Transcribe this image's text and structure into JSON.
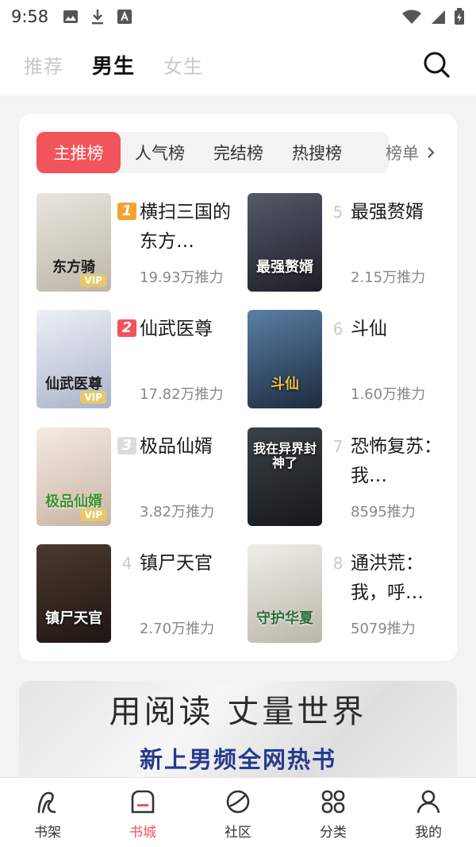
{
  "status": {
    "time": "9:58"
  },
  "top_tabs": [
    {
      "label": "推荐"
    },
    {
      "label": "男生"
    },
    {
      "label": "女生"
    }
  ],
  "rank_tabs": [
    {
      "label": "主推榜"
    },
    {
      "label": "人气榜"
    },
    {
      "label": "完结榜"
    },
    {
      "label": "热搜榜"
    }
  ],
  "rank_more": "榜单",
  "books": [
    {
      "rank": "1",
      "title": "横扫三国的东方…",
      "metric": "19.93万推力",
      "cover_text": "东方骑",
      "cover_color": "#d8d4cc"
    },
    {
      "rank": "2",
      "title": "仙武医尊",
      "metric": "17.82万推力",
      "cover_text": "仙武医尊",
      "cover_color": "#cfd6e4"
    },
    {
      "rank": "3",
      "title": "极品仙婿",
      "metric": "3.82万推力",
      "cover_text": "极品仙婿",
      "cover_color": "#e4d7cf"
    },
    {
      "rank": "4",
      "title": "镇尸天官",
      "metric": "2.70万推力",
      "cover_text": "镇尸天官",
      "cover_color": "#3a2a22"
    },
    {
      "rank": "5",
      "title": "最强赘婿",
      "metric": "2.15万推力",
      "cover_text": "最强赘婿",
      "cover_color": "#2c2f3a"
    },
    {
      "rank": "6",
      "title": "斗仙",
      "metric": "1.60万推力",
      "cover_text": "斗仙",
      "cover_color": "#2f4a6a"
    },
    {
      "rank": "7",
      "title": "恐怖复苏：我…",
      "metric": "8595推力",
      "cover_text": "我在异界封神了",
      "cover_color": "#2b2f33"
    },
    {
      "rank": "8",
      "title": "通洪荒：我，呼…",
      "metric": "5079推力",
      "cover_text": "守护华夏",
      "cover_color": "#d9d8cf"
    }
  ],
  "vip_badge": "VIP",
  "banner": {
    "title": "用阅读 丈量世界",
    "subtitle": "新上男频全网热书"
  },
  "bottom_nav": [
    {
      "label": "书架"
    },
    {
      "label": "书城"
    },
    {
      "label": "社区"
    },
    {
      "label": "分类"
    },
    {
      "label": "我的"
    }
  ],
  "colors": {
    "accent": "#f2545b",
    "gold": "#f0a531"
  }
}
